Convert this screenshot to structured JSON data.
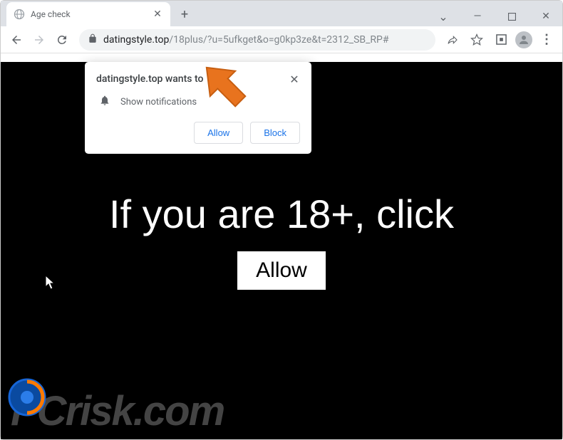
{
  "window": {
    "minimize": "—",
    "maximize": "▢",
    "close": "✕",
    "chevron": "⌄"
  },
  "tab": {
    "title": "Age check",
    "close": "✕"
  },
  "newTabLabel": "+",
  "toolbar": {
    "url_domain": "datingstyle.top",
    "url_path": "/18plus/?u=5ufkget&o=g0kp3ze&t=2312_SB_RP#",
    "menu": "⋮"
  },
  "popup": {
    "title": "datingstyle.top wants to",
    "permission": "Show notifications",
    "allow": "Allow",
    "block": "Block",
    "close": "✕"
  },
  "page": {
    "heading": "If you are 18+, click",
    "button": "Allow"
  },
  "watermark": {
    "text": "PCrisk.com"
  }
}
